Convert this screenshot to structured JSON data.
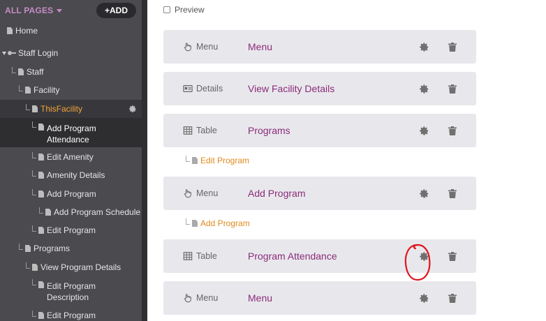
{
  "sidebar": {
    "header": {
      "title": "ALL PAGES",
      "add_label": "+ADD"
    },
    "items": [
      {
        "label": "Home"
      },
      {
        "label": "Staff Login"
      },
      {
        "label": "Staff"
      },
      {
        "label": "Facility"
      },
      {
        "label": "ThisFacility"
      },
      {
        "label": "Add Program\nAttendance"
      },
      {
        "label": "Edit Amenity"
      },
      {
        "label": "Amenity Details"
      },
      {
        "label": "Add Program"
      },
      {
        "label": "Add Program Schedule"
      },
      {
        "label": "Edit Program"
      },
      {
        "label": "Programs"
      },
      {
        "label": "View Program Details"
      },
      {
        "label": "Edit Program\nDescription"
      },
      {
        "label": "Edit Program"
      }
    ]
  },
  "main": {
    "preview_label": "Preview",
    "views": [
      {
        "type": "Menu",
        "icon": "pointer-hand-icon",
        "name": "Menu"
      },
      {
        "type": "Details",
        "icon": "details-card-icon",
        "name": "View Facility Details"
      },
      {
        "type": "Table",
        "icon": "table-grid-icon",
        "name": "Programs"
      },
      {
        "type": "Menu",
        "icon": "pointer-hand-icon",
        "name": "Add Program"
      },
      {
        "type": "Table",
        "icon": "table-grid-icon",
        "name": "Program Attendance"
      },
      {
        "type": "Menu",
        "icon": "pointer-hand-icon",
        "name": "Menu"
      }
    ],
    "children": [
      {
        "label": "Edit Program"
      },
      {
        "label": "Add Program"
      }
    ]
  },
  "colors": {
    "sidebar_bg": "#4a4a4f",
    "accent_purple": "#8b2b7a",
    "active_orange": "#f2a23a",
    "annotation_red": "#e0141e"
  }
}
